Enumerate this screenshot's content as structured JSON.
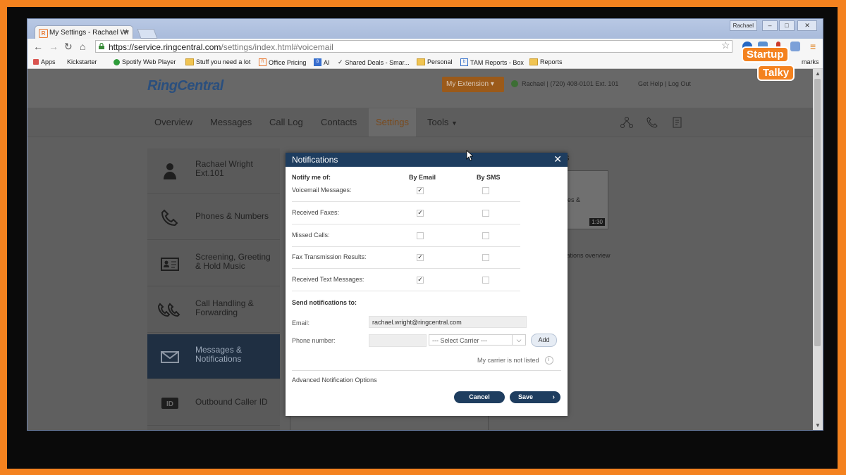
{
  "browser": {
    "tab_title": "My Settings - Rachael Wr",
    "tab_favicon": "R",
    "user_badge": "Rachael",
    "url_host": "https://service.ringcentral.com",
    "url_rest": "/settings/index.html#voicemail",
    "bookmarks": [
      "Apps",
      "Kickstarter",
      "Spotify Web Player",
      "Stuff you need a lot",
      "Office Pricing",
      "AI",
      "Shared Deals - Smar...",
      "Personal",
      "TAM Reports - Box",
      "Reports"
    ],
    "bookmarks_overflow": "marks"
  },
  "header": {
    "logo_main": "RingCentral",
    "extension_button": "My Extension",
    "user_info": "Rachael | (720) 408-0101 Ext. 101",
    "help_links": "Get Help  |  Log Out"
  },
  "mainnav": {
    "items": [
      "Overview",
      "Messages",
      "Call Log",
      "Contacts",
      "Settings",
      "Tools"
    ]
  },
  "sidebar": {
    "items": [
      {
        "label": "Rachael Wright Ext.101"
      },
      {
        "label": "Phones & Numbers"
      },
      {
        "label": "Screening, Greeting & Hold Music"
      },
      {
        "label": "Call Handling & Forwarding"
      },
      {
        "label": "Messages & Notifications"
      },
      {
        "label": "Outbound Caller ID"
      }
    ]
  },
  "right_panel": {
    "heading": "s",
    "video_title": "ages &",
    "video_time": "1:30",
    "video_caption": "ications overview"
  },
  "modal": {
    "title": "Notifications",
    "col_notify": "Notify me of:",
    "col_email": "By Email",
    "col_sms": "By SMS",
    "rows": [
      {
        "label": "Voicemail Messages:",
        "email": true,
        "sms": false
      },
      {
        "label": "Received Faxes:",
        "email": true,
        "sms": false
      },
      {
        "label": "Missed Calls:",
        "email": false,
        "sms": false
      },
      {
        "label": "Fax Transmission Results:",
        "email": true,
        "sms": false
      },
      {
        "label": "Received Text Messages:",
        "email": true,
        "sms": false
      }
    ],
    "send_to": "Send notifications to:",
    "email_label": "Email:",
    "email_value": "rachael.wright@ringcentral.com",
    "phone_label": "Phone number:",
    "carrier_selected": "--- Select Carrier ---",
    "add_button": "Add",
    "carrier_not_listed": "My carrier is not listed",
    "advanced_options": "Advanced Notification Options",
    "cancel_button": "Cancel",
    "save_button": "Save"
  },
  "overlay_logo": {
    "line1": "Startup",
    "line2": "Talky"
  },
  "colors": {
    "frame_orange": "#f4821f",
    "modal_header": "#1e3d5f",
    "button_navy": "#1e3d5f"
  }
}
